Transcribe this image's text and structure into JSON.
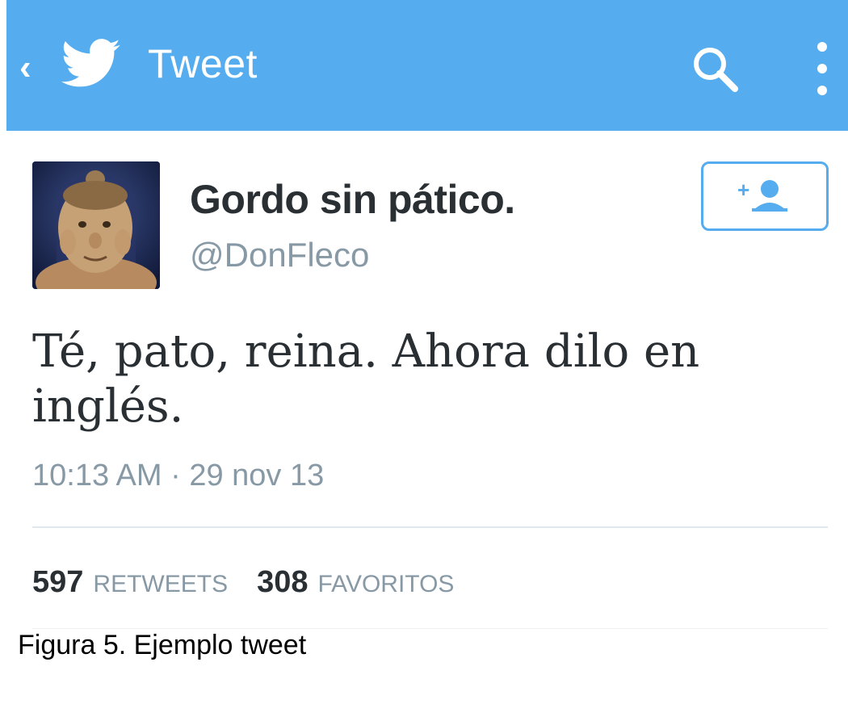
{
  "header": {
    "title": "Tweet",
    "back_icon": "chevron-left-icon",
    "logo_icon": "twitter-bird-icon",
    "search_icon": "search-icon",
    "overflow_icon": "overflow-menu-icon",
    "background_color": "#55acee"
  },
  "tweet": {
    "display_name": "Gordo sin pático.",
    "handle": "@DonFleco",
    "text": "Té, pato, reina. Ahora dilo en inglés.",
    "timestamp": "10:13 AM · 29 nov 13",
    "follow_icon": "add-user-icon",
    "stats": {
      "retweets_count": "597",
      "retweets_label": "RETWEETS",
      "favorites_count": "308",
      "favorites_label": "FAVORITOS"
    }
  },
  "caption": "Figura 5. Ejemplo tweet"
}
